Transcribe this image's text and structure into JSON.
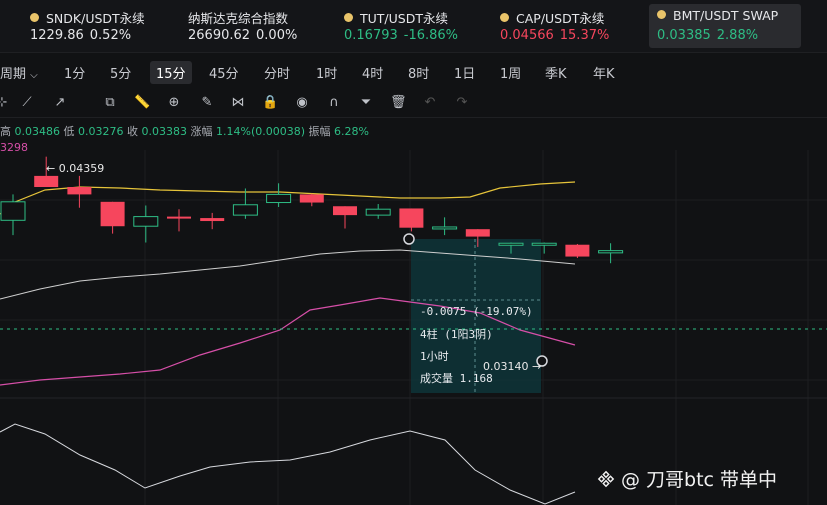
{
  "tickers": [
    {
      "name": "SNDK/USDT永续",
      "price": "1229.86",
      "change": "0.52%",
      "dir": "neu",
      "dot": true
    },
    {
      "name": "纳斯达克综合指数",
      "price": "26690.62",
      "change": "0.00%",
      "dir": "neu",
      "dot": false
    },
    {
      "name": "TUT/USDT永续",
      "price": "0.16793",
      "change": "-16.86%",
      "dir": "up",
      "dot": true
    },
    {
      "name": "CAP/USDT永续",
      "price": "0.04566",
      "change": "15.37%",
      "dir": "down",
      "dot": true
    },
    {
      "name": "BMT/USDT SWAP",
      "price": "0.03385",
      "change": "2.88%",
      "dir": "up",
      "dot": true,
      "active": true
    }
  ],
  "intervals": [
    "周期",
    "1分",
    "5分",
    "15分",
    "45分",
    "分时",
    "1时",
    "4时",
    "8时",
    "1日",
    "1周",
    "季K",
    "年K"
  ],
  "selected_interval": "15分",
  "ohlc": {
    "high_label": "高",
    "high": "0.03486",
    "low_label": "低",
    "low": "0.03276",
    "close_label": "收",
    "close": "0.03383",
    "change_label": "涨幅",
    "change": "1.14%(0.00038)",
    "amp_label": "振幅",
    "amp": "6.28%"
  },
  "ma_label": "3298",
  "annotations": {
    "high_marker": "← 0.04359",
    "measure_pct": "-0.0075 (-19.07%)",
    "measure_bars": "4柱 (1阳3阴)",
    "measure_time": "1小时",
    "measure_volume": "成交量 1.168",
    "low_marker": "0.03140 →"
  },
  "watermark": "@ 刀哥btc  带单中",
  "colors": {
    "up": "#2ebd85",
    "down": "#f6465d",
    "bg": "#111214",
    "ma_yellow": "#e6c43a",
    "ma_white": "#cfcfcf",
    "ma_pink": "#d64fa8"
  },
  "chart_data": {
    "type": "candlestick",
    "candles": [
      {
        "o": 0.035,
        "h": 0.0385,
        "l": 0.033,
        "c": 0.0375
      },
      {
        "o": 0.041,
        "h": 0.0436,
        "l": 0.0395,
        "c": 0.0395
      },
      {
        "o": 0.0395,
        "h": 0.041,
        "l": 0.0367,
        "c": 0.0385
      },
      {
        "o": 0.0375,
        "h": 0.0375,
        "l": 0.0332,
        "c": 0.0342
      },
      {
        "o": 0.0342,
        "h": 0.037,
        "l": 0.032,
        "c": 0.0355
      },
      {
        "o": 0.0355,
        "h": 0.0365,
        "l": 0.0335,
        "c": 0.0353
      },
      {
        "o": 0.0353,
        "h": 0.036,
        "l": 0.0338,
        "c": 0.0349
      },
      {
        "o": 0.0357,
        "h": 0.0393,
        "l": 0.0352,
        "c": 0.0371
      },
      {
        "o": 0.0374,
        "h": 0.04,
        "l": 0.0368,
        "c": 0.0385
      },
      {
        "o": 0.0385,
        "h": 0.0386,
        "l": 0.0369,
        "c": 0.0374
      },
      {
        "o": 0.0369,
        "h": 0.0369,
        "l": 0.0339,
        "c": 0.0357
      },
      {
        "o": 0.0357,
        "h": 0.0372,
        "l": 0.0352,
        "c": 0.0365
      },
      {
        "o": 0.0366,
        "h": 0.0366,
        "l": 0.0335,
        "c": 0.034
      },
      {
        "o": 0.0341,
        "h": 0.0354,
        "l": 0.033,
        "c": 0.0341
      },
      {
        "o": 0.0338,
        "h": 0.0338,
        "l": 0.0314,
        "c": 0.0328
      },
      {
        "o": 0.0318,
        "h": 0.032,
        "l": 0.0305,
        "c": 0.0319
      },
      {
        "o": 0.0318,
        "h": 0.032,
        "l": 0.0305,
        "c": 0.0319
      },
      {
        "o": 0.0317,
        "h": 0.0318,
        "l": 0.0299,
        "c": 0.0301
      },
      {
        "o": 0.0306,
        "h": 0.0319,
        "l": 0.0292,
        "c": 0.0309
      }
    ],
    "current_price": 0.03383
  }
}
